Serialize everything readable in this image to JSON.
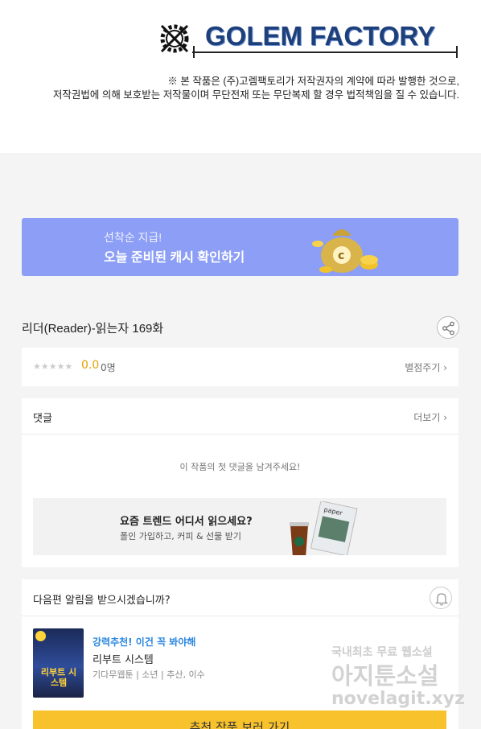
{
  "header": {
    "logo_text": "GOLEM FACTORY",
    "notice_line1": "※ 본 작품은 (주)고렘팩토리가 저작권자의 계약에 따라 발행한 것으로,",
    "notice_line2": "저작권법에 의해 보호받는 저작물이며 무단전재 또는 무단복제 할 경우 법적책임을 질 수 있습니다."
  },
  "banner": {
    "subtitle": "선착순 지급!",
    "title": "오늘 준비된 캐시 확인하기"
  },
  "episode": {
    "title": "리더(Reader)-읽는자 169화",
    "stars": "★★★★★",
    "score": "0.0",
    "count": "0명",
    "rate_link": "별점주기 ›"
  },
  "comments": {
    "title": "댓글",
    "more": "더보기 ›",
    "empty": "이 작품의 첫 댓글을 남겨주세요!",
    "promo_title": "요즘 트렌드 어디서 읽으세요?",
    "promo_sub": "폴인 가입하고, 커피 & 선물 받기"
  },
  "next": {
    "title": "다음편 알림을 받으시겠습니까?",
    "rec_tag": "강력추천! 이건 꼭 봐야해",
    "rec_name": "리부트 시스템",
    "rec_meta": "기다무웹툰 | 소년 | 추산, 이수",
    "thumb_text": "리부트 시스템",
    "cta": "추천 작품 보러 가기"
  },
  "watermark": {
    "line1": "국내최초 무료 웹소설",
    "line2": "아지툰소설",
    "line3": "novelagit.xyz"
  },
  "colors": {
    "banner": "#8c9ef5",
    "accent_yellow": "#f7c22c",
    "score": "#e6a100",
    "rec_tag": "#2a86e0"
  }
}
